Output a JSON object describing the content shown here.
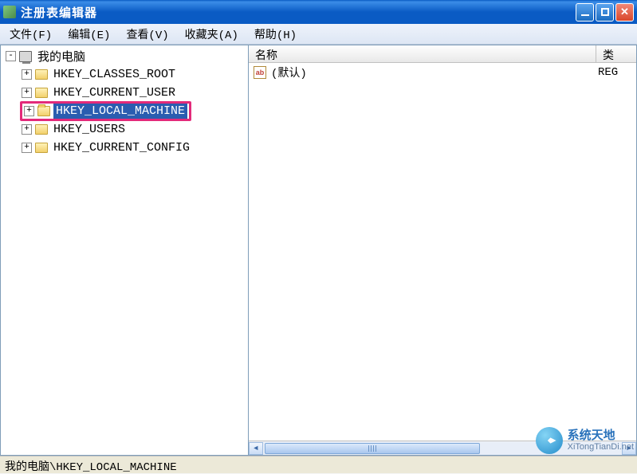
{
  "titlebar": {
    "title": "注册表编辑器"
  },
  "menu": {
    "file": "文件(F)",
    "edit": "编辑(E)",
    "view": "查看(V)",
    "favorites": "收藏夹(A)",
    "help": "帮助(H)"
  },
  "tree": {
    "root": "我的电脑",
    "items": [
      {
        "label": "HKEY_CLASSES_ROOT",
        "selected": false,
        "highlighted": false
      },
      {
        "label": "HKEY_CURRENT_USER",
        "selected": false,
        "highlighted": false
      },
      {
        "label": "HKEY_LOCAL_MACHINE",
        "selected": true,
        "highlighted": true
      },
      {
        "label": "HKEY_USERS",
        "selected": false,
        "highlighted": false
      },
      {
        "label": "HKEY_CURRENT_CONFIG",
        "selected": false,
        "highlighted": false
      }
    ]
  },
  "list": {
    "columns": {
      "name": "名称",
      "type": "类型"
    },
    "type_truncated": "类",
    "rows": [
      {
        "icon": "ab",
        "name": "(默认)",
        "type": "REG"
      }
    ]
  },
  "statusbar": {
    "path": "我的电脑\\HKEY_LOCAL_MACHINE"
  },
  "watermark": {
    "name": "系统天地",
    "url": "XiTongTianDi.net"
  },
  "expander": {
    "plus": "+",
    "minus": "-"
  }
}
